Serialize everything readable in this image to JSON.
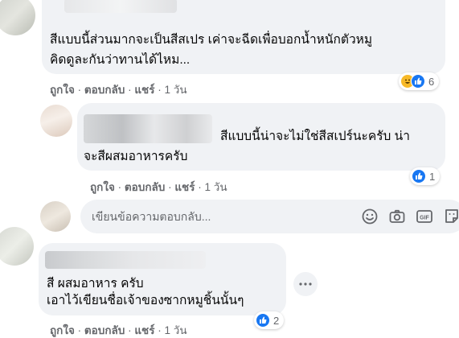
{
  "comments": [
    {
      "text_line1": "สีแบบนี้ส่วนมากจะเป็นสีสเปร เค่าจะฉีดเพื่อบอกน้ำหนักตัวหมู",
      "text_line2": "คิดดูละกันว่าทานได้ไหม...",
      "like": "ถูกใจ",
      "reply": "ตอบกลับ",
      "share": "แชร์",
      "sep": "·",
      "time": "1 วัน",
      "reaction_count": "6",
      "reactions": [
        "haha",
        "like"
      ]
    },
    {
      "text_line1": "สีแบบนี้น่าจะไม่ใช่สีสเปร์นะครับ น่า",
      "text_line2": "จะสีผสมอาหารครับ",
      "like": "ถูกใจ",
      "reply": "ตอบกลับ",
      "share": "แชร์",
      "sep": "·",
      "time": "1 วัน",
      "reaction_count": "1",
      "reactions": [
        "like"
      ]
    },
    {
      "text_line1": "สี ผสมอาหาร ครับ",
      "text_line2": "เอาไว้เขียนชื่อเจ้าของซากหมูชิ้นนั้นๆ",
      "like": "ถูกใจ",
      "reply": "ตอบกลับ",
      "share": "แชร์",
      "sep": "·",
      "time": "1 วัน",
      "reaction_count": "2",
      "reactions": [
        "like"
      ]
    }
  ],
  "reply_box": {
    "placeholder": "เขียนข้อความตอบกลับ...",
    "icons": [
      "emoji-icon",
      "camera-icon",
      "gif-icon",
      "sticker-icon"
    ]
  },
  "colors": {
    "bubble": "#f0f2f5",
    "meta_text": "#65676b",
    "like_blue": "#1877f2",
    "haha_yellow": "#f7b928"
  }
}
